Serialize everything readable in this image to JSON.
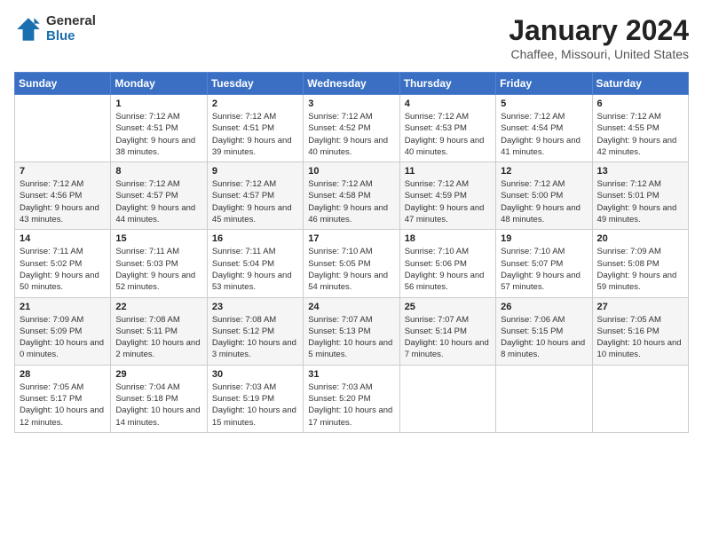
{
  "header": {
    "logo_general": "General",
    "logo_blue": "Blue",
    "title": "January 2024",
    "location": "Chaffee, Missouri, United States"
  },
  "weekdays": [
    "Sunday",
    "Monday",
    "Tuesday",
    "Wednesday",
    "Thursday",
    "Friday",
    "Saturday"
  ],
  "weeks": [
    [
      {
        "day": "",
        "sunrise": "",
        "sunset": "",
        "daylight": ""
      },
      {
        "day": "1",
        "sunrise": "Sunrise: 7:12 AM",
        "sunset": "Sunset: 4:51 PM",
        "daylight": "Daylight: 9 hours and 38 minutes."
      },
      {
        "day": "2",
        "sunrise": "Sunrise: 7:12 AM",
        "sunset": "Sunset: 4:51 PM",
        "daylight": "Daylight: 9 hours and 39 minutes."
      },
      {
        "day": "3",
        "sunrise": "Sunrise: 7:12 AM",
        "sunset": "Sunset: 4:52 PM",
        "daylight": "Daylight: 9 hours and 40 minutes."
      },
      {
        "day": "4",
        "sunrise": "Sunrise: 7:12 AM",
        "sunset": "Sunset: 4:53 PM",
        "daylight": "Daylight: 9 hours and 40 minutes."
      },
      {
        "day": "5",
        "sunrise": "Sunrise: 7:12 AM",
        "sunset": "Sunset: 4:54 PM",
        "daylight": "Daylight: 9 hours and 41 minutes."
      },
      {
        "day": "6",
        "sunrise": "Sunrise: 7:12 AM",
        "sunset": "Sunset: 4:55 PM",
        "daylight": "Daylight: 9 hours and 42 minutes."
      }
    ],
    [
      {
        "day": "7",
        "sunrise": "Sunrise: 7:12 AM",
        "sunset": "Sunset: 4:56 PM",
        "daylight": "Daylight: 9 hours and 43 minutes."
      },
      {
        "day": "8",
        "sunrise": "Sunrise: 7:12 AM",
        "sunset": "Sunset: 4:57 PM",
        "daylight": "Daylight: 9 hours and 44 minutes."
      },
      {
        "day": "9",
        "sunrise": "Sunrise: 7:12 AM",
        "sunset": "Sunset: 4:57 PM",
        "daylight": "Daylight: 9 hours and 45 minutes."
      },
      {
        "day": "10",
        "sunrise": "Sunrise: 7:12 AM",
        "sunset": "Sunset: 4:58 PM",
        "daylight": "Daylight: 9 hours and 46 minutes."
      },
      {
        "day": "11",
        "sunrise": "Sunrise: 7:12 AM",
        "sunset": "Sunset: 4:59 PM",
        "daylight": "Daylight: 9 hours and 47 minutes."
      },
      {
        "day": "12",
        "sunrise": "Sunrise: 7:12 AM",
        "sunset": "Sunset: 5:00 PM",
        "daylight": "Daylight: 9 hours and 48 minutes."
      },
      {
        "day": "13",
        "sunrise": "Sunrise: 7:12 AM",
        "sunset": "Sunset: 5:01 PM",
        "daylight": "Daylight: 9 hours and 49 minutes."
      }
    ],
    [
      {
        "day": "14",
        "sunrise": "Sunrise: 7:11 AM",
        "sunset": "Sunset: 5:02 PM",
        "daylight": "Daylight: 9 hours and 50 minutes."
      },
      {
        "day": "15",
        "sunrise": "Sunrise: 7:11 AM",
        "sunset": "Sunset: 5:03 PM",
        "daylight": "Daylight: 9 hours and 52 minutes."
      },
      {
        "day": "16",
        "sunrise": "Sunrise: 7:11 AM",
        "sunset": "Sunset: 5:04 PM",
        "daylight": "Daylight: 9 hours and 53 minutes."
      },
      {
        "day": "17",
        "sunrise": "Sunrise: 7:10 AM",
        "sunset": "Sunset: 5:05 PM",
        "daylight": "Daylight: 9 hours and 54 minutes."
      },
      {
        "day": "18",
        "sunrise": "Sunrise: 7:10 AM",
        "sunset": "Sunset: 5:06 PM",
        "daylight": "Daylight: 9 hours and 56 minutes."
      },
      {
        "day": "19",
        "sunrise": "Sunrise: 7:10 AM",
        "sunset": "Sunset: 5:07 PM",
        "daylight": "Daylight: 9 hours and 57 minutes."
      },
      {
        "day": "20",
        "sunrise": "Sunrise: 7:09 AM",
        "sunset": "Sunset: 5:08 PM",
        "daylight": "Daylight: 9 hours and 59 minutes."
      }
    ],
    [
      {
        "day": "21",
        "sunrise": "Sunrise: 7:09 AM",
        "sunset": "Sunset: 5:09 PM",
        "daylight": "Daylight: 10 hours and 0 minutes."
      },
      {
        "day": "22",
        "sunrise": "Sunrise: 7:08 AM",
        "sunset": "Sunset: 5:11 PM",
        "daylight": "Daylight: 10 hours and 2 minutes."
      },
      {
        "day": "23",
        "sunrise": "Sunrise: 7:08 AM",
        "sunset": "Sunset: 5:12 PM",
        "daylight": "Daylight: 10 hours and 3 minutes."
      },
      {
        "day": "24",
        "sunrise": "Sunrise: 7:07 AM",
        "sunset": "Sunset: 5:13 PM",
        "daylight": "Daylight: 10 hours and 5 minutes."
      },
      {
        "day": "25",
        "sunrise": "Sunrise: 7:07 AM",
        "sunset": "Sunset: 5:14 PM",
        "daylight": "Daylight: 10 hours and 7 minutes."
      },
      {
        "day": "26",
        "sunrise": "Sunrise: 7:06 AM",
        "sunset": "Sunset: 5:15 PM",
        "daylight": "Daylight: 10 hours and 8 minutes."
      },
      {
        "day": "27",
        "sunrise": "Sunrise: 7:05 AM",
        "sunset": "Sunset: 5:16 PM",
        "daylight": "Daylight: 10 hours and 10 minutes."
      }
    ],
    [
      {
        "day": "28",
        "sunrise": "Sunrise: 7:05 AM",
        "sunset": "Sunset: 5:17 PM",
        "daylight": "Daylight: 10 hours and 12 minutes."
      },
      {
        "day": "29",
        "sunrise": "Sunrise: 7:04 AM",
        "sunset": "Sunset: 5:18 PM",
        "daylight": "Daylight: 10 hours and 14 minutes."
      },
      {
        "day": "30",
        "sunrise": "Sunrise: 7:03 AM",
        "sunset": "Sunset: 5:19 PM",
        "daylight": "Daylight: 10 hours and 15 minutes."
      },
      {
        "day": "31",
        "sunrise": "Sunrise: 7:03 AM",
        "sunset": "Sunset: 5:20 PM",
        "daylight": "Daylight: 10 hours and 17 minutes."
      },
      {
        "day": "",
        "sunrise": "",
        "sunset": "",
        "daylight": ""
      },
      {
        "day": "",
        "sunrise": "",
        "sunset": "",
        "daylight": ""
      },
      {
        "day": "",
        "sunrise": "",
        "sunset": "",
        "daylight": ""
      }
    ]
  ]
}
